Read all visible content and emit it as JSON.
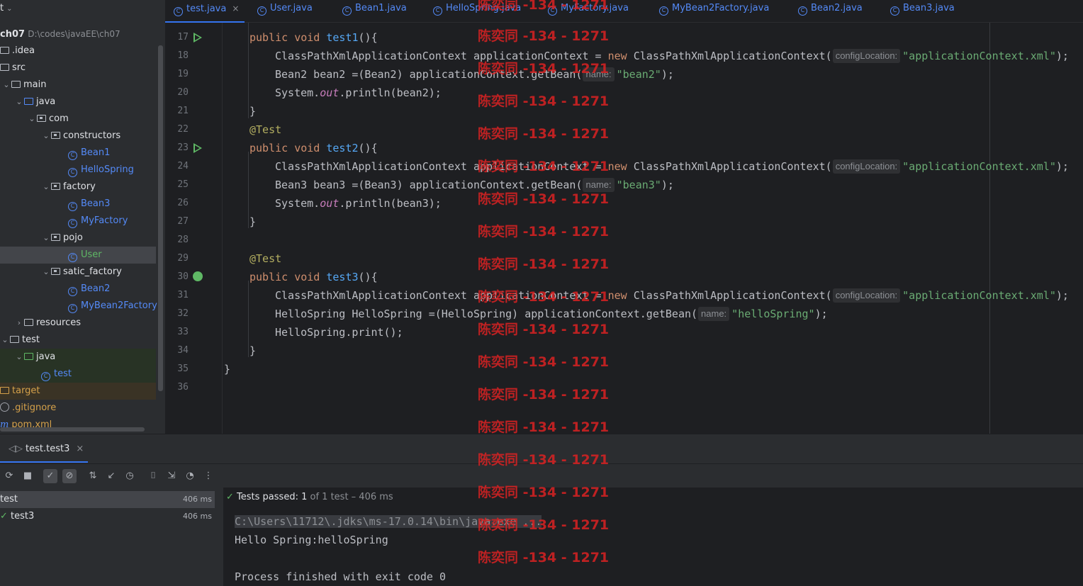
{
  "project": {
    "header": "t",
    "root_name": "ch07",
    "root_path": "D:\\codes\\javaEE\\ch07",
    "items": [
      {
        "label": ".idea",
        "kind": "folder"
      },
      {
        "label": "src",
        "kind": "folder"
      },
      {
        "label": "main",
        "kind": "folder"
      },
      {
        "label": "java",
        "kind": "folder"
      },
      {
        "label": "com",
        "kind": "package"
      },
      {
        "label": "constructors",
        "kind": "package"
      },
      {
        "label": "Bean1",
        "kind": "class"
      },
      {
        "label": "HelloSpring",
        "kind": "class"
      },
      {
        "label": "factory",
        "kind": "package"
      },
      {
        "label": "Bean3",
        "kind": "class"
      },
      {
        "label": "MyFactory",
        "kind": "class"
      },
      {
        "label": "pojo",
        "kind": "package"
      },
      {
        "label": "User",
        "kind": "class"
      },
      {
        "label": "satic_factory",
        "kind": "package"
      },
      {
        "label": "Bean2",
        "kind": "class"
      },
      {
        "label": "MyBean2Factory",
        "kind": "class"
      },
      {
        "label": "resources",
        "kind": "folder"
      },
      {
        "label": "test",
        "kind": "folder"
      },
      {
        "label": "java",
        "kind": "folder"
      },
      {
        "label": "test",
        "kind": "class"
      },
      {
        "label": "target",
        "kind": "folder"
      },
      {
        "label": ".gitignore",
        "kind": "file"
      },
      {
        "label": "pom.xml",
        "kind": "maven"
      }
    ]
  },
  "tabs": [
    "test.java",
    "User.java",
    "Bean1.java",
    "HelloSpring.java",
    "MyFactory.java",
    "MyBean2Factory.java",
    "Bean2.java",
    "Bean3.java"
  ],
  "editor": {
    "line_numbers": [
      "17",
      "18",
      "19",
      "20",
      "21",
      "22",
      "23",
      "24",
      "25",
      "26",
      "27",
      "28",
      "29",
      "30",
      "31",
      "32",
      "33",
      "34",
      "35",
      "36"
    ],
    "hint_config": "configLocation:",
    "hint_name": "name:",
    "xml": "\"applicationContext.xml\"",
    "bean2": "\"bean2\"",
    "bean3": "\"bean3\"",
    "hellospring": "\"helloSpring\""
  },
  "watermark": "陈奕同 -134 - 1271",
  "run": {
    "tab_label": "test.test3",
    "tree": [
      {
        "label": "test",
        "time": "406 ms"
      },
      {
        "label": "test3",
        "time": "406 ms"
      }
    ],
    "status_prefix": "Tests passed:",
    "status_count": "1",
    "status_suffix": "of 1 test – 406 ms",
    "console": {
      "cmd": "C:\\Users\\11712\\.jdks\\ms-17.0.14\\bin\\java.exe ...",
      "output": "Hello Spring:helloSpring",
      "exit": "Process finished with exit code 0"
    }
  },
  "colors": {
    "accent": "#3574f0",
    "keyword": "#cf8e6d",
    "string": "#6aab73",
    "function": "#56a8f5",
    "annotation": "#b3ae60",
    "watermark": "#da2222",
    "pass": "#5fb865"
  }
}
